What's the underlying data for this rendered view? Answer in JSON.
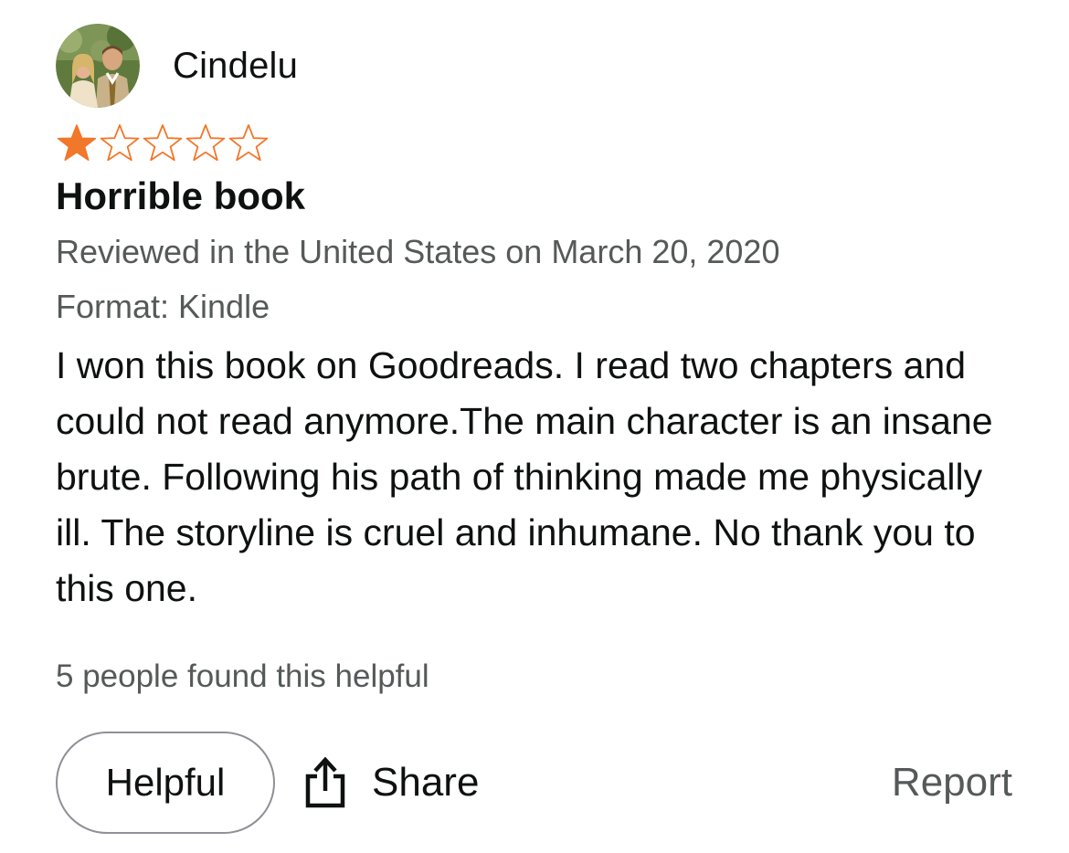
{
  "review": {
    "author": "Cindelu",
    "rating": 1,
    "max_rating": 5,
    "title": "Horrible book",
    "reviewed_line": "Reviewed in the United States on March 20, 2020",
    "format_line": "Format: Kindle",
    "body": "I won this book on Goodreads. I read two chapters and could not read anymore.The main character is an insane brute. Following his path of thinking made me physically ill. The storyline is cruel and inhumane. No thank you to this one.",
    "helpful_count_text": "5 people found this helpful"
  },
  "actions": {
    "helpful_label": "Helpful",
    "share_label": "Share",
    "report_label": "Report"
  },
  "colors": {
    "star_filled": "#f1772b",
    "star_outline": "#f1772b",
    "secondary_text": "#565959",
    "primary_text": "#0f1111",
    "button_border": "#8d9096"
  },
  "icons": {
    "avatar": "avatar-photo",
    "star": "star-icon",
    "share": "share-icon"
  }
}
